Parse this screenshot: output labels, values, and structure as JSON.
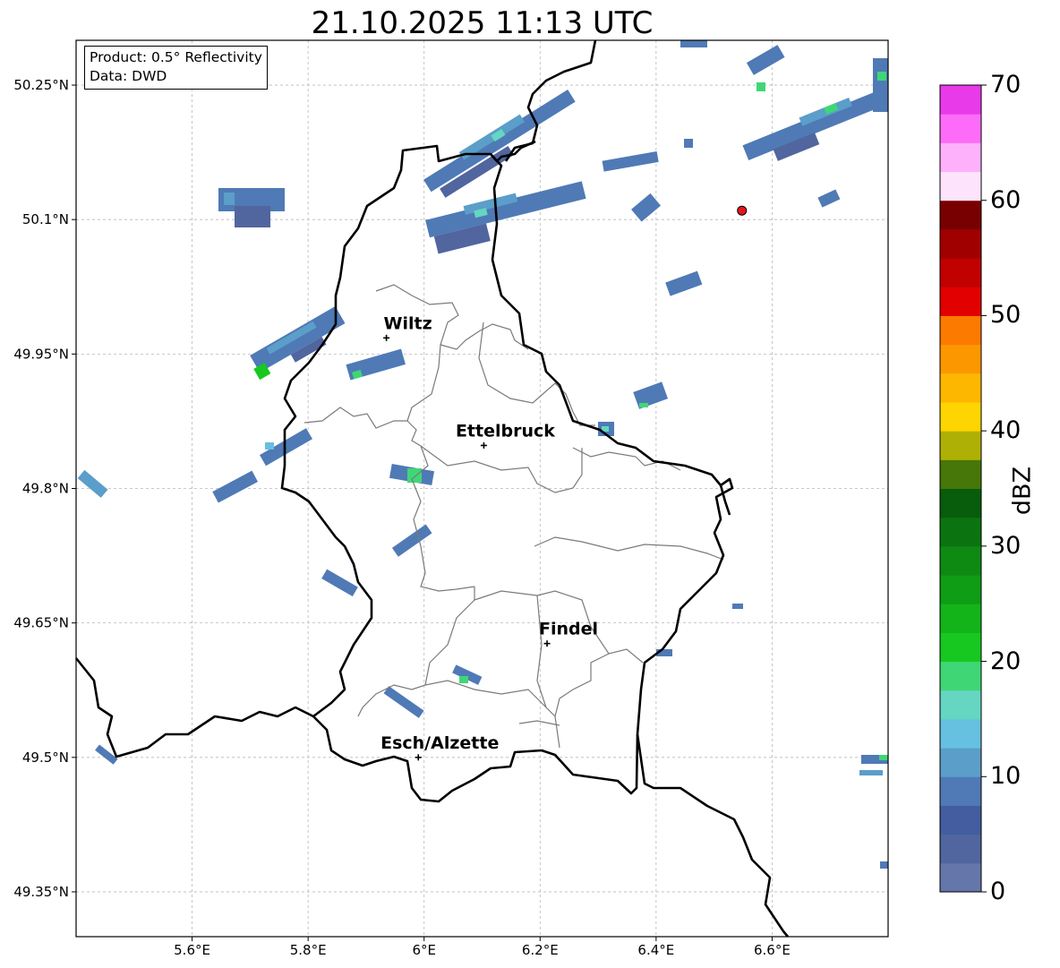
{
  "title": "21.10.2025 11:13 UTC",
  "info": {
    "product": "Product: 0.5° Reflectivity",
    "data": "Data: DWD"
  },
  "map": {
    "lon_range": [
      5.4,
      6.8
    ],
    "lat_range": [
      49.3,
      50.3
    ],
    "lon_ticks": [
      "5.6°E",
      "5.8°E",
      "6°E",
      "6.2°E",
      "6.4°E",
      "6.6°E"
    ],
    "lat_ticks": [
      "50.25°N",
      "50.1°N",
      "49.95°N",
      "49.8°N",
      "49.65°N",
      "49.5°N",
      "49.35°N"
    ],
    "cities": [
      {
        "name": "Wiltz",
        "lon": 5.935,
        "lat": 49.968
      },
      {
        "name": "Ettelbruck",
        "lon": 6.103,
        "lat": 49.848
      },
      {
        "name": "Findel",
        "lon": 6.212,
        "lat": 49.627
      },
      {
        "name": "Esch/Alzette",
        "lon": 5.99,
        "lat": 49.5
      }
    ],
    "radar_site": {
      "lon": 6.548,
      "lat": 50.11,
      "color": "#e8141c"
    },
    "grid": true
  },
  "colorbar": {
    "label": "dBZ",
    "ticks": [
      "0",
      "10",
      "20",
      "30",
      "40",
      "50",
      "60",
      "70"
    ],
    "min": 0,
    "max": 70,
    "step": 2.5,
    "colors": [
      "#6577aa",
      "#51659f",
      "#435da0",
      "#4f7ab5",
      "#5b9ec9",
      "#66c0df",
      "#64d6c2",
      "#3fd776",
      "#16c81f",
      "#12b41a",
      "#109d16",
      "#0e8a13",
      "#0b7410",
      "#075d0b",
      "#467708",
      "#afb005",
      "#fed500",
      "#fdb700",
      "#fd9700",
      "#fd7a00",
      "#e30000",
      "#c10000",
      "#a10000",
      "#790000",
      "#fee3fd",
      "#fdb1fb",
      "#fd6cf8",
      "#e93ae9"
    ]
  }
}
